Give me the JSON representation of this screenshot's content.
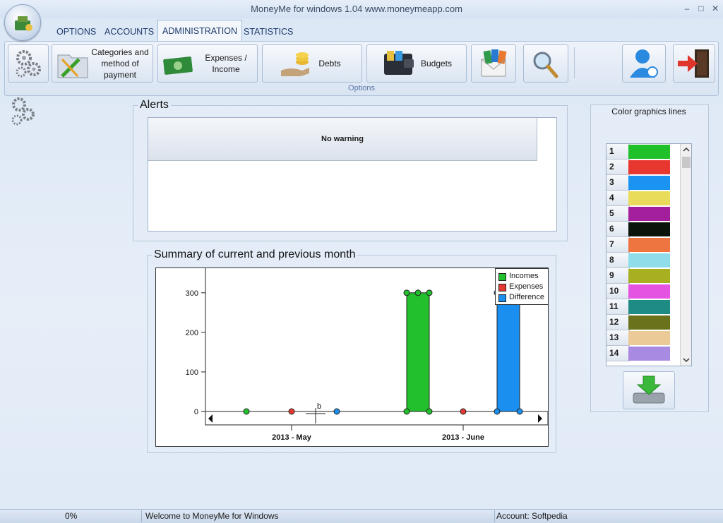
{
  "window": {
    "title": "MoneyMe for windows 1.04 www.moneymeapp.com",
    "minimize": "–",
    "maximize": "□",
    "close": "✕"
  },
  "tabs": [
    {
      "label": "OPTIONS"
    },
    {
      "label": "ACCOUNTS"
    },
    {
      "label": "ADMINISTRATION",
      "active": true
    },
    {
      "label": "STATISTICS"
    }
  ],
  "ribbon": {
    "caption": "Options",
    "categories_label": "Categories and method of payment",
    "expenses_label": "Expenses / Income",
    "debts_label": "Debts",
    "budgets_label": "Budgets"
  },
  "alerts": {
    "title": "Alerts",
    "message": "No warning"
  },
  "summary": {
    "title": "Summary of current and previous month"
  },
  "chart_data": {
    "type": "bar",
    "categories": [
      "2013 - May",
      "2013 - June"
    ],
    "series": [
      {
        "name": "Incomes",
        "color": "#22c02c",
        "values": [
          0,
          300
        ]
      },
      {
        "name": "Expenses",
        "color": "#e23a32",
        "values": [
          0,
          0
        ]
      },
      {
        "name": "Difference",
        "color": "#1b8ff0",
        "values": [
          0,
          300
        ]
      }
    ],
    "y_ticks": [
      "0",
      "100",
      "200",
      "300"
    ],
    "ylim": [
      0,
      330
    ],
    "legend": "top-right",
    "annotation": "b"
  },
  "color_lines": {
    "title": "Color graphics lines",
    "rows": [
      {
        "num": "1",
        "color": "#1fc02a"
      },
      {
        "num": "2",
        "color": "#e8372f"
      },
      {
        "num": "3",
        "color": "#1a93f2"
      },
      {
        "num": "4",
        "color": "#e8dc5a"
      },
      {
        "num": "5",
        "color": "#a31f9c"
      },
      {
        "num": "6",
        "color": "#0b140b"
      },
      {
        "num": "7",
        "color": "#ee7440"
      },
      {
        "num": "8",
        "color": "#8fdcea"
      },
      {
        "num": "9",
        "color": "#a8b022"
      },
      {
        "num": "10",
        "color": "#e453e2"
      },
      {
        "num": "11",
        "color": "#1f8b85"
      },
      {
        "num": "12",
        "color": "#6b721c"
      },
      {
        "num": "13",
        "color": "#ecca97"
      },
      {
        "num": "14",
        "color": "#a98ae3"
      }
    ]
  },
  "status": {
    "progress": "0%",
    "message": "Welcome to MoneyMe for Windows",
    "account": "Account: Softpedia"
  }
}
